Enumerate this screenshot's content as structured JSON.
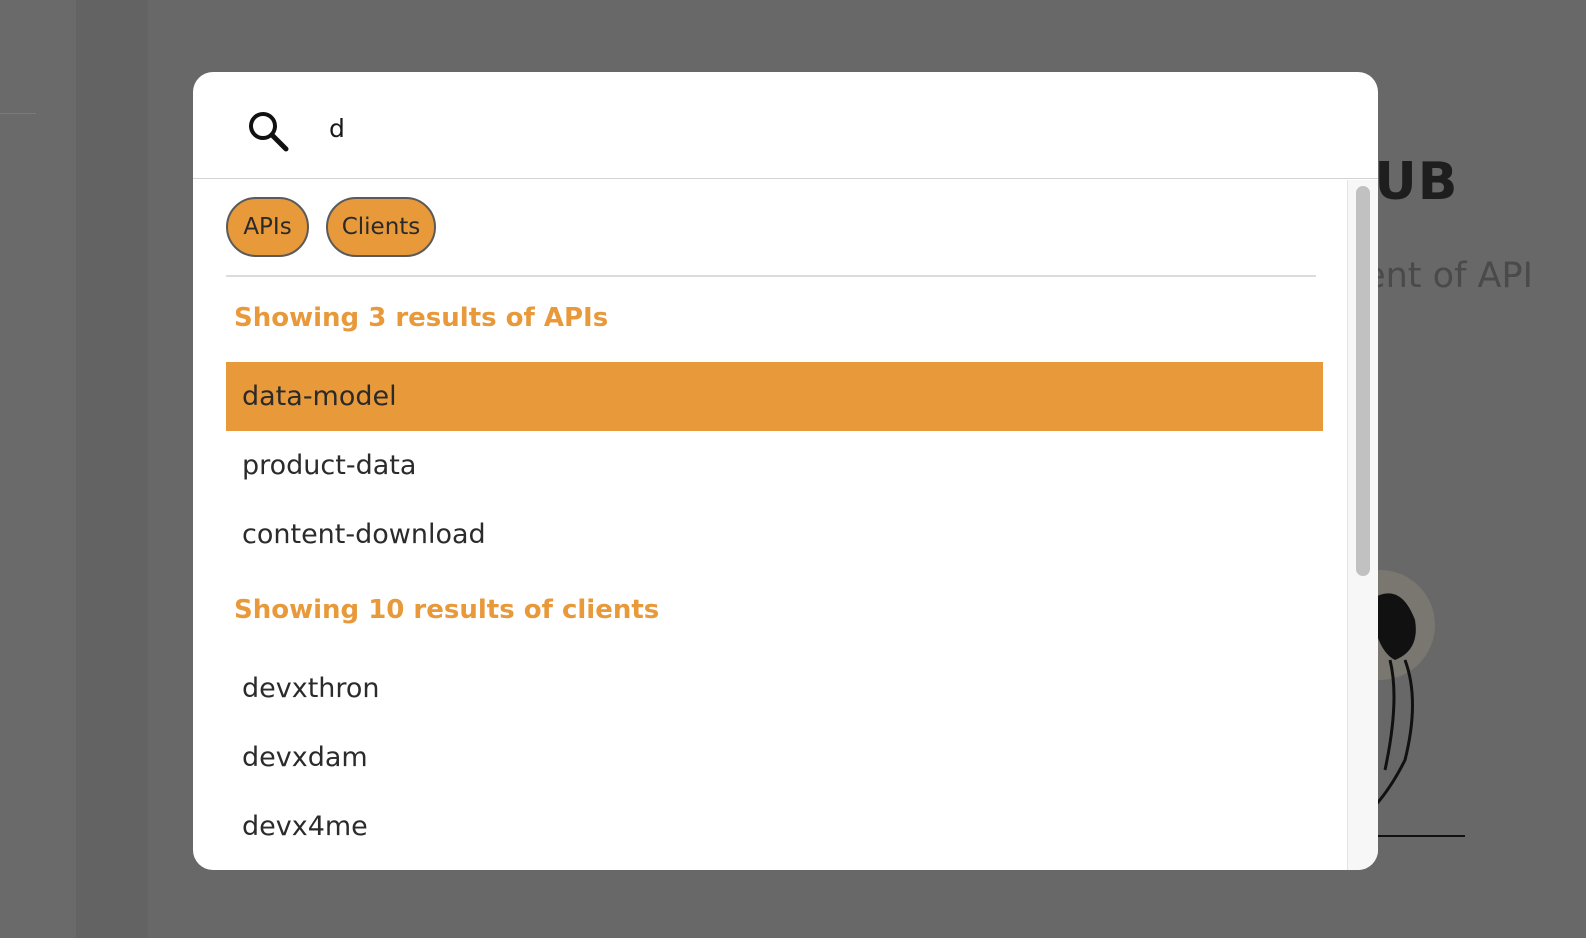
{
  "background": {
    "title": "HUB",
    "subtitle": "ment of API"
  },
  "search": {
    "value": "d",
    "icon": "search-icon"
  },
  "filters": [
    {
      "label": "APIs"
    },
    {
      "label": "Clients"
    }
  ],
  "sections": {
    "apis": {
      "heading": "Showing 3 results of APIs",
      "items": [
        "data-model",
        "product-data",
        "content-download"
      ],
      "selected": "data-model"
    },
    "clients": {
      "heading": "Showing 10 results of clients",
      "items": [
        "devxthron",
        "devxdam",
        "devx4me"
      ]
    }
  },
  "colors": {
    "accent": "#e8993a",
    "overlay": "#686868",
    "text": "#2b2b2b"
  }
}
